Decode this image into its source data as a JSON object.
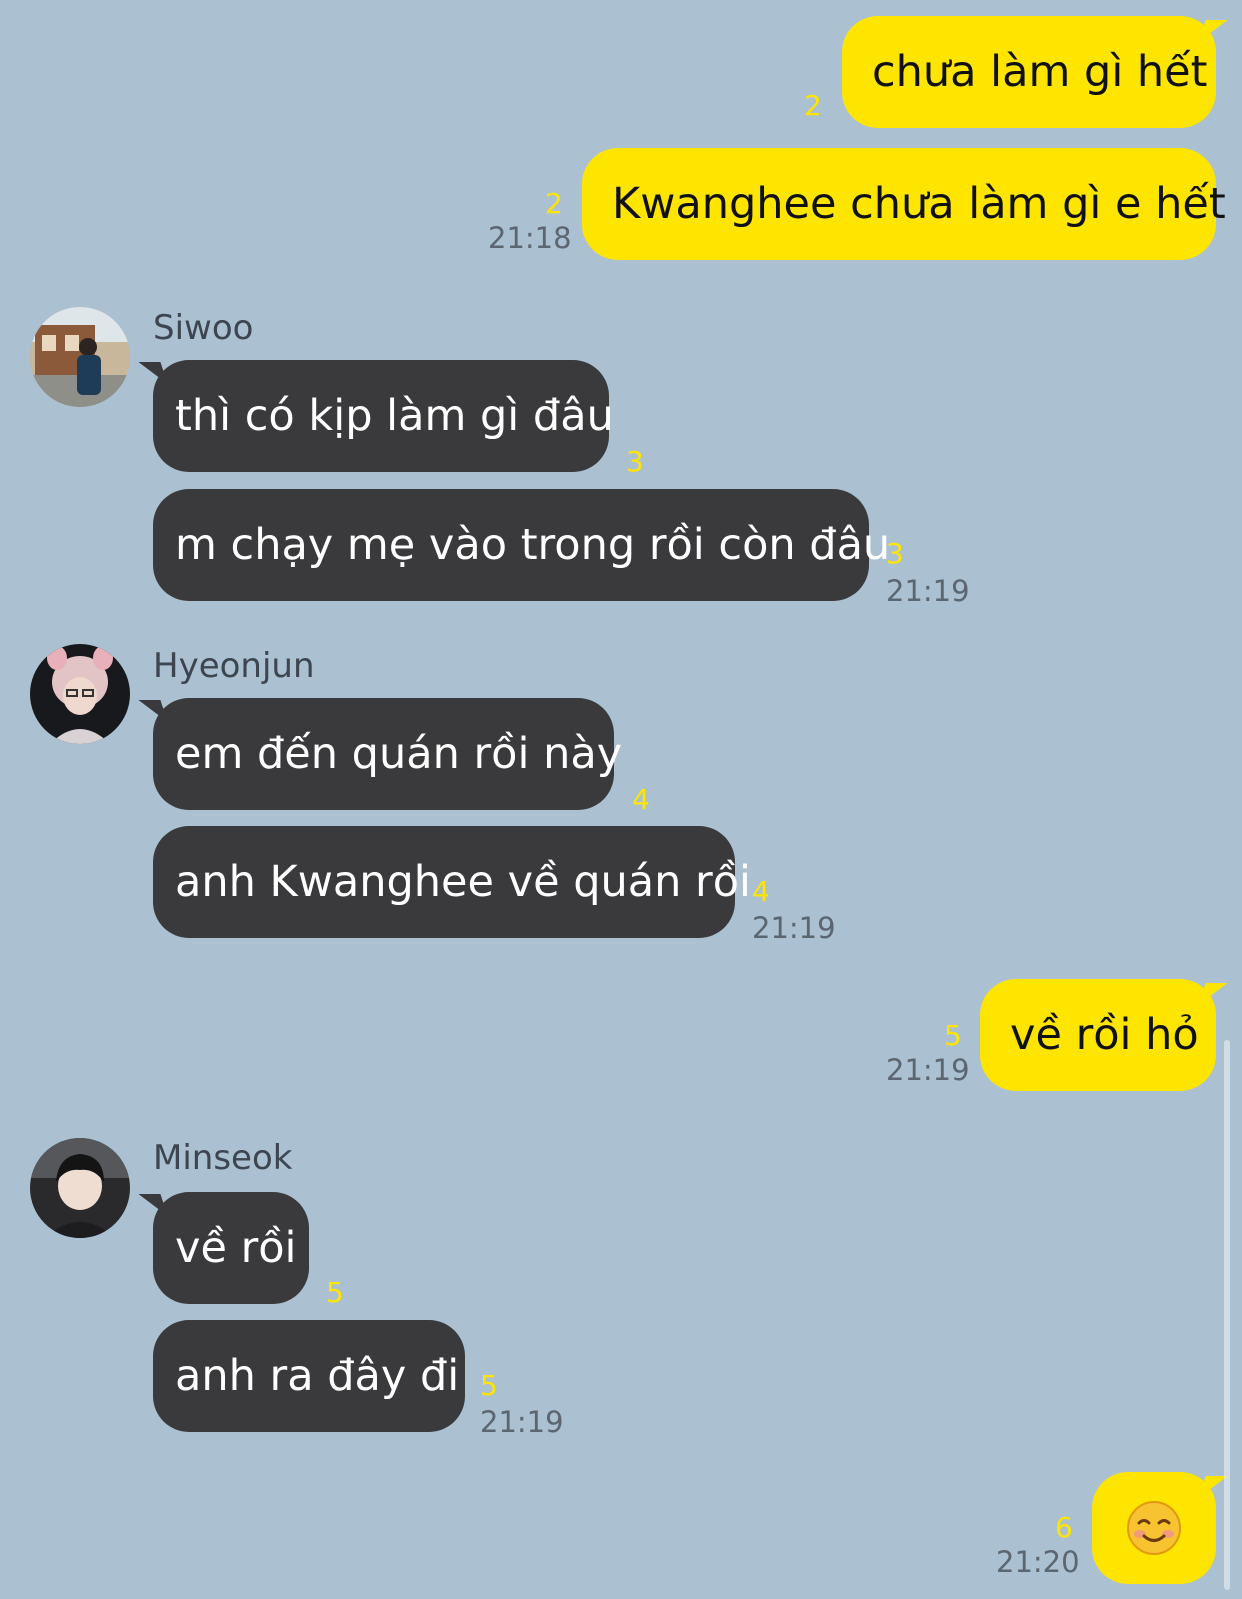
{
  "colors": {
    "background": "#abc1d1",
    "my_bubble": "#fee500",
    "other_bubble": "#3a3a3c",
    "unread_count": "#fee500",
    "timestamp": "#5b6670"
  },
  "messages": [
    {
      "from": "me",
      "text": "chưa làm gì hết",
      "unread": "2"
    },
    {
      "from": "me",
      "text": "Kwanghee chưa làm gì e hết",
      "unread": "2",
      "time": "21:18"
    },
    {
      "from": "Siwoo",
      "text": "thì có kịp làm gì đâu",
      "unread": "3"
    },
    {
      "from": "Siwoo",
      "text": "m chạy mẹ vào trong rồi còn đâu",
      "unread": "3",
      "time": "21:19"
    },
    {
      "from": "Hyeonjun",
      "text": "em đến quán rồi này",
      "unread": "4"
    },
    {
      "from": "Hyeonjun",
      "text": "anh Kwanghee về quán rồi",
      "unread": "4",
      "time": "21:19"
    },
    {
      "from": "me",
      "text": "về rồi hỏ",
      "unread": "5",
      "time": "21:19"
    },
    {
      "from": "Minseok",
      "text": "về rồi",
      "unread": "5"
    },
    {
      "from": "Minseok",
      "text": "anh ra đây đi",
      "unread": "5",
      "time": "21:19"
    },
    {
      "from": "me",
      "emoji": "smiling-face-emoji",
      "unread": "6",
      "time": "21:20"
    }
  ],
  "senders": {
    "siwoo": {
      "name": "Siwoo",
      "avatar_icon": "profile-photo"
    },
    "hyeonjun": {
      "name": "Hyeonjun",
      "avatar_icon": "profile-photo"
    },
    "minseok": {
      "name": "Minseok",
      "avatar_icon": "profile-photo"
    }
  }
}
